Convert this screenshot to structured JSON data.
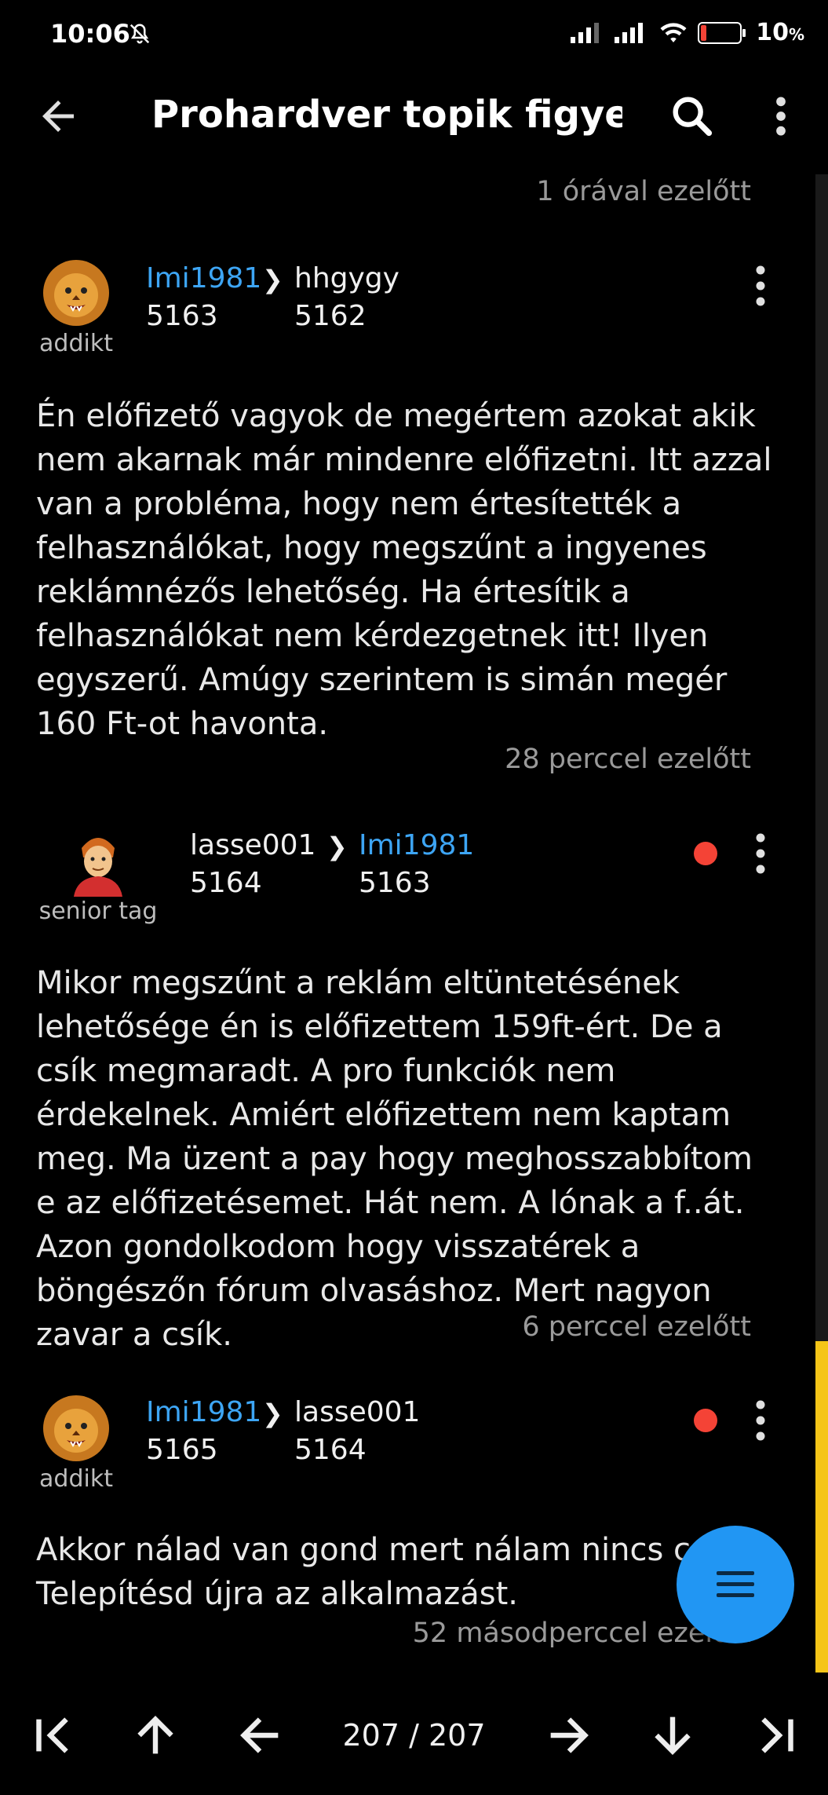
{
  "status_bar": {
    "time": "10:06",
    "battery_percent": "10",
    "battery_unit": "%",
    "icons": [
      "mute-bell-icon",
      "signal-icon",
      "signal-icon",
      "wifi-icon",
      "battery-icon"
    ]
  },
  "app_bar": {
    "title": "Prohardver topik figyel...",
    "icons": [
      "back-arrow-icon",
      "search-icon",
      "more-vert-icon"
    ]
  },
  "top_timestamp": "1 órával ezelőtt",
  "posts": [
    {
      "author": "Imi1981",
      "author_rank": "addikt",
      "reply_to": "hhgygy",
      "post_number": "5163",
      "reply_number": "5162",
      "unread": false,
      "body": "Én előfizető vagyok de megértem azokat akik nem akarnak már mindenre előfizetni. Itt azzal van a probléma, hogy nem értesítették a felhasználókat, hogy megszűnt a ingyenes reklámnézős lehetőség. Ha értesítik a felhasználókat nem kérdezgetnek itt! Ilyen egyszerű. Amúgy szerintem is simán megér 160 Ft-ot havonta.",
      "time": "28 perccel ezelőtt"
    },
    {
      "author": "lasse001",
      "author_rank": "senior tag",
      "reply_to": "Imi1981",
      "post_number": "5164",
      "reply_number": "5163",
      "unread": true,
      "body": "Mikor megszűnt a reklám eltüntetésének lehetősége én is előfizettem 159ft-ért. De a csík megmaradt. A pro funkciók nem érdekelnek. Amiért előfizettem nem kaptam meg. Ma üzent a pay hogy meghosszabbítom e az előfizetésemet. Hát nem. A lónak a f..át. Azon gondolkodom hogy visszatérek a böngészőn fórum olvasáshoz. Mert nagyon zavar a csík.",
      "time": "6 perccel ezelőtt"
    },
    {
      "author": "Imi1981",
      "author_rank": "addikt",
      "reply_to": "lasse001",
      "post_number": "5165",
      "reply_number": "5164",
      "unread": true,
      "body": "Akkor nálad van gond mert nálam nincs csík. Telepítésd újra az alkalmazást.",
      "time": "52 másodperccel ezelőtt"
    }
  ],
  "pager": {
    "text": "207 / 207",
    "buttons": [
      "first-page-icon",
      "arrow-up-icon",
      "arrow-left-icon",
      "arrow-right-icon",
      "arrow-down-icon",
      "last-page-icon"
    ]
  },
  "fab": {
    "icon": "menu-icon"
  },
  "colors": {
    "background": "#000000",
    "link": "#3da5f4",
    "accent": "#2196f3",
    "unread": "#f44336",
    "scrollbar": "#f5c518"
  }
}
